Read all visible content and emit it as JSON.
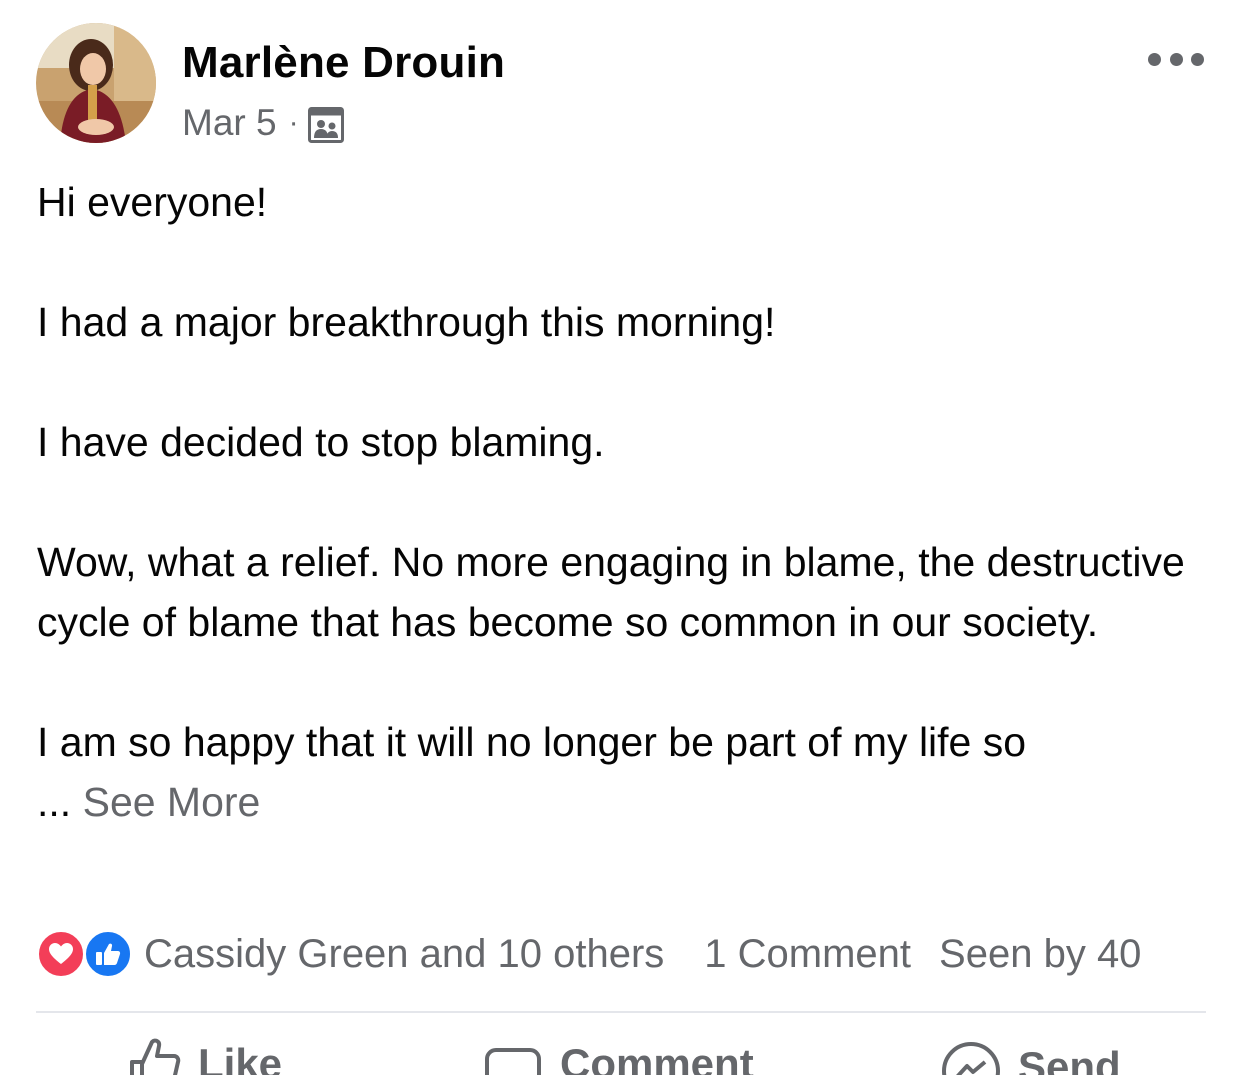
{
  "post": {
    "author": "Marlène Drouin",
    "date": "Mar 5",
    "separator": "·",
    "audience_icon": "group-members-icon",
    "body_lines": [
      "Hi everyone!",
      "I had a major breakthrough this morning!",
      "I have decided to stop blaming.",
      "Wow, what a relief. No more engaging in blame, the destructive cycle of blame that has become so common in our society.",
      "I am so happy that it will no longer be part of my life so"
    ],
    "see_more_prefix": "...",
    "see_more_label": "See More"
  },
  "reactions": {
    "icons": [
      "love-reaction-icon",
      "like-reaction-icon"
    ],
    "reactors_text": "Cassidy Green and 10 others",
    "comments_text": "1 Comment",
    "seen_text": "Seen by 40"
  },
  "actions": {
    "like_label": "Like",
    "comment_label": "Comment",
    "send_label": "Send"
  },
  "colors": {
    "text": "#050505",
    "secondary": "#65676b",
    "love": "#f33e58",
    "like": "#1877f2",
    "divider": "#e4e6eb"
  }
}
